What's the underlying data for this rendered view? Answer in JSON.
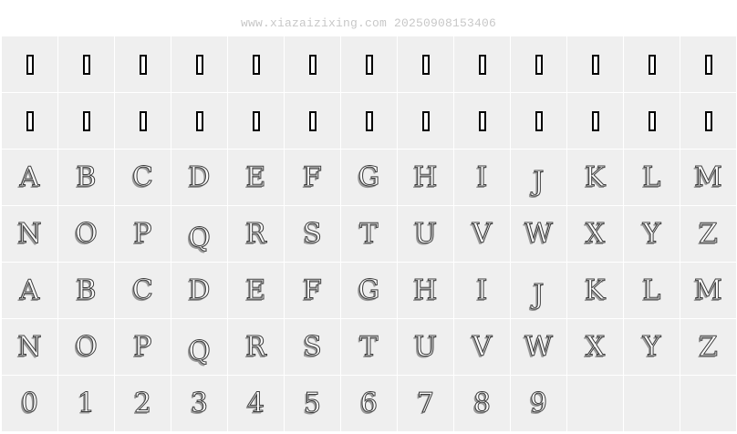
{
  "header": {
    "text": "www.xiazaizixing.com 20250908153406"
  },
  "grid": {
    "rows": [
      {
        "type": "notdef",
        "cells": [
          "",
          "",
          "",
          "",
          "",
          "",
          "",
          "",
          "",
          "",
          "",
          "",
          ""
        ]
      },
      {
        "type": "notdef",
        "cells": [
          "",
          "",
          "",
          "",
          "",
          "",
          "",
          "",
          "",
          "",
          "",
          "",
          ""
        ]
      },
      {
        "type": "glyph",
        "cells": [
          "A",
          "B",
          "C",
          "D",
          "E",
          "F",
          "G",
          "H",
          "I",
          "J",
          "K",
          "L",
          "M"
        ]
      },
      {
        "type": "glyph",
        "cells": [
          "N",
          "O",
          "P",
          "Q",
          "R",
          "S",
          "T",
          "U",
          "V",
          "W",
          "X",
          "Y",
          "Z"
        ]
      },
      {
        "type": "glyph",
        "cells": [
          "a",
          "b",
          "c",
          "d",
          "e",
          "f",
          "g",
          "h",
          "i",
          "j",
          "k",
          "l",
          "m"
        ]
      },
      {
        "type": "glyph",
        "cells": [
          "n",
          "o",
          "p",
          "q",
          "r",
          "s",
          "t",
          "u",
          "v",
          "w",
          "x",
          "y",
          "z"
        ]
      },
      {
        "type": "glyph",
        "cells": [
          "0",
          "1",
          "2",
          "3",
          "4",
          "5",
          "6",
          "7",
          "8",
          "9",
          "",
          "",
          ""
        ]
      }
    ],
    "display_case_upper": true
  }
}
